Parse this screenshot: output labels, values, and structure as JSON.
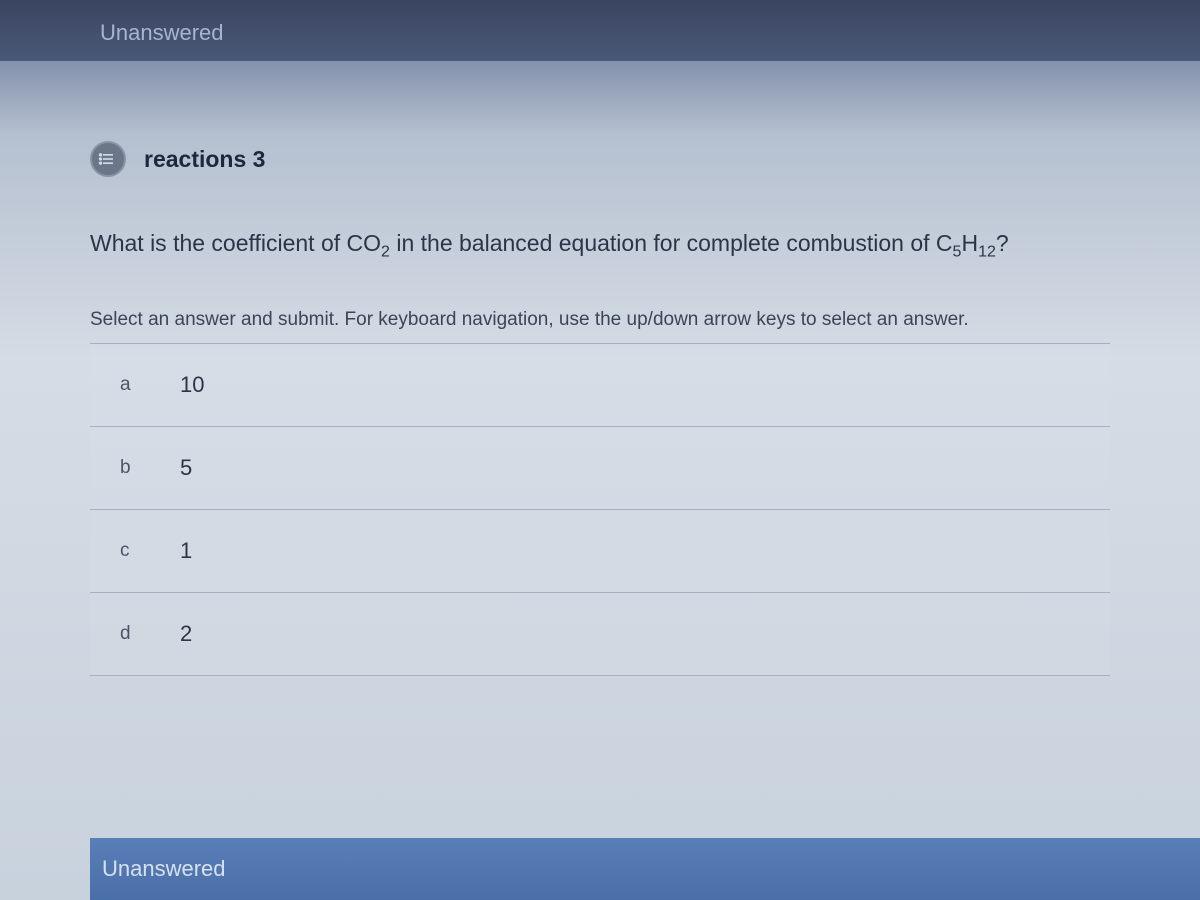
{
  "header": {
    "status": "Unanswered"
  },
  "question": {
    "title": "reactions 3",
    "text_before": "What is the coefficient of CO",
    "sub1": "2",
    "text_middle": " in the balanced equation for complete combustion of C",
    "sub2": "5",
    "text_h": "H",
    "sub3": "12",
    "text_after": "?",
    "instruction": "Select an answer and submit. For keyboard navigation, use the up/down arrow keys to select an answer."
  },
  "answers": [
    {
      "key": "a",
      "value": "10"
    },
    {
      "key": "b",
      "value": "5"
    },
    {
      "key": "c",
      "value": "1"
    },
    {
      "key": "d",
      "value": "2"
    }
  ],
  "footer": {
    "status": "Unanswered"
  }
}
